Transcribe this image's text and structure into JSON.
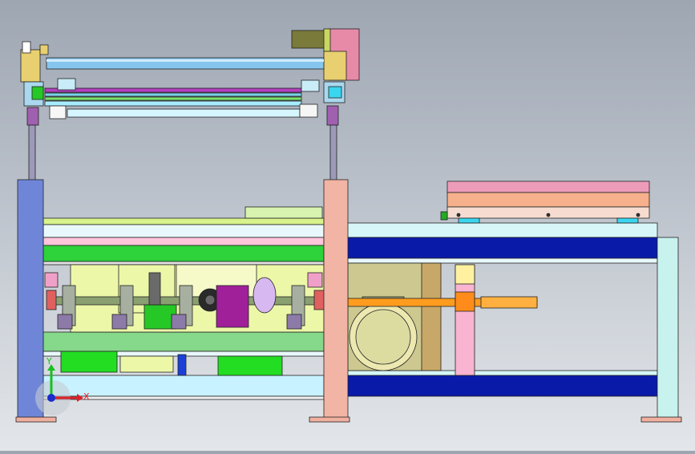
{
  "view": {
    "background_top": "#9ea6b2",
    "background_bottom": "#e3e6ea"
  },
  "triad": {
    "x_label": "X",
    "y_label": "Y",
    "x_color": "#e0202a",
    "y_color": "#18c020",
    "z_color": "#1a2ccc"
  },
  "colors": {
    "frame_blue": "#0a1aa8",
    "post_left": "#6f86d8",
    "post_mid": "#f2b4a4",
    "post_right": "#c8f2ee",
    "roller_cyan": "#7fd8ff",
    "green": "#22dd22",
    "light_green": "#d8f28c",
    "pink": "#ffb0cc",
    "magenta": "#a0209a",
    "orange_screw": "#ff9c1e",
    "olive": "#c8a868",
    "salmon": "#f6b08c"
  },
  "icons": {
    "triad": "coordinate-triad-icon"
  }
}
